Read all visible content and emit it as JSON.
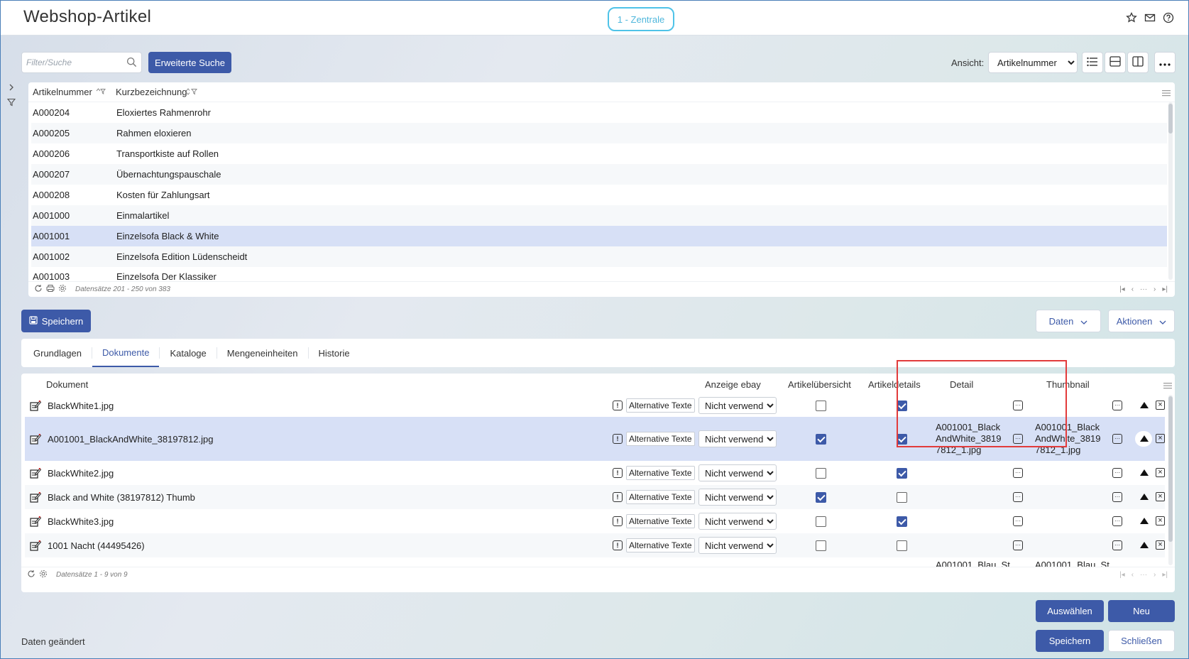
{
  "header": {
    "title": "Webshop-Artikel",
    "tenant": "1 - Zentrale",
    "icons": [
      "star-icon",
      "mail-icon",
      "help-icon"
    ]
  },
  "toolbar": {
    "search_placeholder": "Filter/Suche",
    "search_value": "",
    "extended_search_label": "Erweiterte Suche",
    "view_label": "Ansicht:",
    "view_selected": "Artikelnummer",
    "view_icons": [
      "list-view-icon",
      "horizontal-split-icon",
      "vertical-split-icon",
      "more-icon"
    ]
  },
  "article_grid": {
    "columns": [
      "Artikelnummer",
      "Kurzbezeichnung"
    ],
    "rows": [
      {
        "nr": "A000204",
        "name": "Eloxiertes Rahmenrohr"
      },
      {
        "nr": "A000205",
        "name": "Rahmen eloxieren"
      },
      {
        "nr": "A000206",
        "name": "Transportkiste auf Rollen"
      },
      {
        "nr": "A000207",
        "name": "Übernachtungspauschale"
      },
      {
        "nr": "A000208",
        "name": "Kosten für Zahlungsart"
      },
      {
        "nr": "A001000",
        "name": "Einmalartikel"
      },
      {
        "nr": "A001001",
        "name": "Einzelsofa Black & White",
        "selected": true
      },
      {
        "nr": "A001002",
        "name": "Einzelsofa Edition Lüdenscheidt"
      },
      {
        "nr": "A001003",
        "name": "Einzelsofa Der Klassiker"
      }
    ],
    "footer_text": "Datensätze 201 - 250 von 383"
  },
  "actions": {
    "save_label": "Speichern",
    "data_label": "Daten",
    "actions_label": "Aktionen"
  },
  "tabs": [
    {
      "label": "Grundlagen",
      "active": false
    },
    {
      "label": "Dokumente",
      "active": true
    },
    {
      "label": "Kataloge",
      "active": false
    },
    {
      "label": "Mengeneinheiten",
      "active": false
    },
    {
      "label": "Historie",
      "active": false
    }
  ],
  "document_grid": {
    "columns": {
      "document": "Dokument",
      "ebay": "Anzeige ebay",
      "overview": "Artikelübersicht",
      "details": "Artikeldetails",
      "detail": "Detail",
      "thumbnail": "Thumbnail"
    },
    "alt_text_label": "Alternative Texte",
    "rows": [
      {
        "name": "BlackWhite1.jpg",
        "ebay": "Nicht verwend",
        "overview": false,
        "details": true,
        "detail": "",
        "thumbnail": ""
      },
      {
        "name": "A001001_BlackAndWhite_38197812.jpg",
        "ebay": "Nicht verwend",
        "overview": true,
        "details": true,
        "detail": "A001001_BlackAndWhite_38197812_1.jpg",
        "thumbnail": "A001001_BlackAndWhite_38197812_1.jpg",
        "selected": true
      },
      {
        "name": "BlackWhite2.jpg",
        "ebay": "Nicht verwend",
        "overview": false,
        "details": true,
        "detail": "",
        "thumbnail": ""
      },
      {
        "name": "Black and White (38197812) Thumb",
        "ebay": "Nicht verwend",
        "overview": true,
        "details": false,
        "detail": "",
        "thumbnail": ""
      },
      {
        "name": "BlackWhite3.jpg",
        "ebay": "Nicht verwend",
        "overview": false,
        "details": true,
        "detail": "",
        "thumbnail": ""
      },
      {
        "name": "1001 Nacht (44495426)",
        "ebay": "Nicht verwend",
        "overview": false,
        "details": false,
        "detail": "",
        "thumbnail": ""
      }
    ],
    "partial_row": {
      "detail": "A001001_Blau_St",
      "thumbnail": "A001001_Blau_St"
    },
    "footer_text": "Datensätze 1 - 9 von 9"
  },
  "footer": {
    "select_label": "Auswählen",
    "new_label": "Neu",
    "save_label": "Speichern",
    "close_label": "Schließen",
    "status": "Daten geändert"
  },
  "colors": {
    "primary": "#3d5aa8",
    "selection": "#d7e0f6",
    "tenant_accent": "#4fc3e8",
    "highlight": "#e23b3b"
  }
}
